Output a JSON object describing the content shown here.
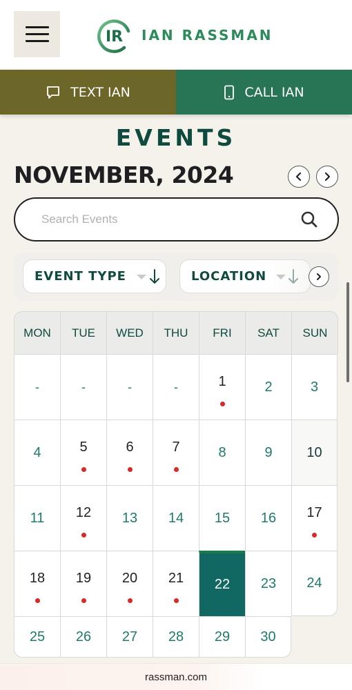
{
  "header": {
    "menu_icon": "hamburger-menu-icon",
    "logo_monogram": "IR",
    "logo_text": "IAN RASSMAN",
    "brand_color": "#2c8a5c"
  },
  "cta": {
    "text_label": "TEXT IAN",
    "text_icon": "chat-bubble-icon",
    "text_color": "#6c6628",
    "call_label": "CALL IAN",
    "call_icon": "mobile-phone-icon",
    "call_color": "#287556"
  },
  "page": {
    "title": "EVENTS",
    "month_label": "NOVEMBER, 2024",
    "prev_icon": "chevron-left-icon",
    "next_icon": "chevron-right-icon"
  },
  "search": {
    "placeholder": "Search Events",
    "value": "",
    "icon": "search-icon"
  },
  "filters": [
    {
      "label": "EVENT TYPE",
      "icon": "arrow-down-icon"
    },
    {
      "label": "LOCATION",
      "icon": "arrow-down-icon"
    }
  ],
  "calendar": {
    "weekdays": [
      "MON",
      "TUE",
      "WED",
      "THU",
      "FRI",
      "SAT",
      "SUN"
    ],
    "today": "22",
    "today_color": "#116862",
    "event_dot_color": "#d42a2a",
    "weeks": [
      [
        {
          "label": "-",
          "event": false,
          "blank": true
        },
        {
          "label": "-",
          "event": false,
          "blank": true
        },
        {
          "label": "-",
          "event": false,
          "blank": true
        },
        {
          "label": "-",
          "event": false,
          "blank": true
        },
        {
          "label": "1",
          "event": true
        },
        {
          "label": "2",
          "event": false
        },
        {
          "label": "3",
          "event": false
        }
      ],
      [
        {
          "label": "4",
          "event": false
        },
        {
          "label": "5",
          "event": true
        },
        {
          "label": "6",
          "event": true
        },
        {
          "label": "7",
          "event": true
        },
        {
          "label": "8",
          "event": false
        },
        {
          "label": "9",
          "event": false
        },
        {
          "label": "10",
          "event": false,
          "shaded": true
        }
      ],
      [
        {
          "label": "11",
          "event": false
        },
        {
          "label": "12",
          "event": true
        },
        {
          "label": "13",
          "event": false
        },
        {
          "label": "14",
          "event": false
        },
        {
          "label": "15",
          "event": false
        },
        {
          "label": "16",
          "event": false
        },
        {
          "label": "17",
          "event": true
        }
      ],
      [
        {
          "label": "18",
          "event": true
        },
        {
          "label": "19",
          "event": true
        },
        {
          "label": "20",
          "event": true
        },
        {
          "label": "21",
          "event": true
        },
        {
          "label": "22",
          "event": false,
          "today": true
        },
        {
          "label": "23",
          "event": false
        },
        {
          "label": "24",
          "event": false
        }
      ],
      [
        {
          "label": "25",
          "event": false
        },
        {
          "label": "26",
          "event": false
        },
        {
          "label": "27",
          "event": false
        },
        {
          "label": "28",
          "event": false
        },
        {
          "label": "29",
          "event": false
        },
        {
          "label": "30",
          "event": false
        }
      ]
    ]
  },
  "browser": {
    "url": "rassman.com"
  }
}
